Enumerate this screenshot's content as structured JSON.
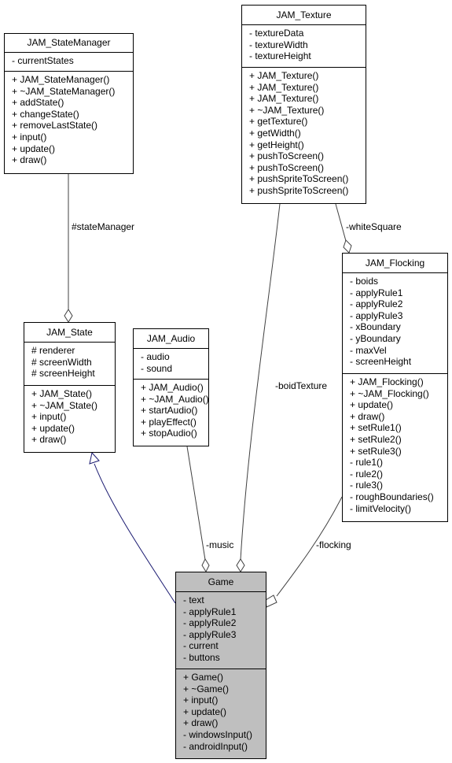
{
  "diagram": {
    "type": "uml-class-collaboration",
    "classes": {
      "stateManager": {
        "name": "JAM_StateManager",
        "attributes": [
          "- currentStates"
        ],
        "methods": [
          "+ JAM_StateManager()",
          "+ ~JAM_StateManager()",
          "+ addState()",
          "+ changeState()",
          "+ removeLastState()",
          "+ input()",
          "+ update()",
          "+ draw()"
        ]
      },
      "texture": {
        "name": "JAM_Texture",
        "attributes": [
          "- textureData",
          "- textureWidth",
          "- textureHeight"
        ],
        "methods": [
          "+ JAM_Texture()",
          "+ JAM_Texture()",
          "+ JAM_Texture()",
          "+ ~JAM_Texture()",
          "+ getTexture()",
          "+ getWidth()",
          "+ getHeight()",
          "+ pushToScreen()",
          "+ pushToScreen()",
          "+ pushSpriteToScreen()",
          "+ pushSpriteToScreen()"
        ]
      },
      "state": {
        "name": "JAM_State",
        "attributes": [
          "# renderer",
          "# screenWidth",
          "# screenHeight"
        ],
        "methods": [
          "+ JAM_State()",
          "+ ~JAM_State()",
          "+ input()",
          "+ update()",
          "+ draw()"
        ]
      },
      "audio": {
        "name": "JAM_Audio",
        "attributes": [
          "- audio",
          "- sound"
        ],
        "methods": [
          "+ JAM_Audio()",
          "+ ~JAM_Audio()",
          "+ startAudio()",
          "+ playEffect()",
          "+ stopAudio()"
        ]
      },
      "flocking": {
        "name": "JAM_Flocking",
        "attributes": [
          "- boids",
          "- applyRule1",
          "- applyRule2",
          "- applyRule3",
          "- xBoundary",
          "- yBoundary",
          "- maxVel",
          "- screenHeight"
        ],
        "methods": [
          "+ JAM_Flocking()",
          "+ ~JAM_Flocking()",
          "+ update()",
          "+ draw()",
          "+ setRule1()",
          "+ setRule2()",
          "+ setRule3()",
          "- rule1()",
          "- rule2()",
          "- rule3()",
          "- roughBoundaries()",
          "- limitVelocity()"
        ]
      },
      "game": {
        "name": "Game",
        "attributes": [
          "- text",
          "- applyRule1",
          "- applyRule2",
          "- applyRule3",
          "- current",
          "- buttons"
        ],
        "methods": [
          "+ Game()",
          "+ ~Game()",
          "+ input()",
          "+ update()",
          "+ draw()",
          "- windowsInput()",
          "- androidInput()"
        ]
      }
    },
    "relations": [
      {
        "from": "JAM_StateManager",
        "to": "JAM_State",
        "kind": "composition-usage",
        "label": "#stateManager"
      },
      {
        "from": "JAM_Texture",
        "to": "JAM_Flocking",
        "kind": "composition-usage",
        "label": "-whiteSquare"
      },
      {
        "from": "JAM_Texture",
        "to": "Game",
        "kind": "composition-usage",
        "label": "-boidTexture"
      },
      {
        "from": "JAM_Audio",
        "to": "Game",
        "kind": "composition-usage",
        "label": "-music"
      },
      {
        "from": "JAM_Flocking",
        "to": "Game",
        "kind": "composition-usage",
        "label": "-flocking"
      },
      {
        "from": "Game",
        "to": "JAM_State",
        "kind": "inheritance",
        "label": ""
      }
    ],
    "colors": {
      "usage_edge": "#404040",
      "inheritance_edge": "#191970",
      "highlight_fill": "#bfbfbf",
      "box_border": "#000000"
    }
  }
}
